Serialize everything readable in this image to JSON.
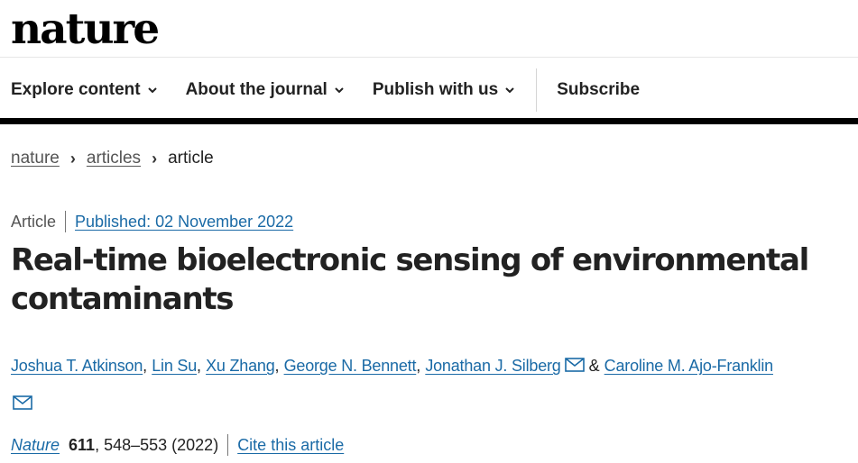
{
  "site": {
    "logo": "nature"
  },
  "nav": {
    "explore": "Explore content",
    "about": "About the journal",
    "publish": "Publish with us",
    "subscribe": "Subscribe"
  },
  "breadcrumb": {
    "home": "nature",
    "section": "articles",
    "current": "article"
  },
  "article": {
    "type": "Article",
    "published": "Published: 02 November 2022",
    "title": "Real-time bioelectronic sensing of environmental contaminants",
    "authors": [
      "Joshua T. Atkinson",
      "Lin Su",
      "Xu Zhang",
      "George N. Bennett",
      "Jonathan J. Silberg",
      "Caroline M. Ajo-Franklin"
    ],
    "author_sep": ",",
    "author_amp": "&",
    "citation": {
      "journal": "Nature",
      "volume": "611",
      "pages_year": ", 548–553 (2022)",
      "cite_link": "Cite this article"
    }
  },
  "colors": {
    "link": "#1a6aa6",
    "text": "#222222",
    "rule": "#000000"
  },
  "icons": {
    "nav_caret": "chevron-down-icon",
    "corresponding_author": "mail-icon"
  }
}
